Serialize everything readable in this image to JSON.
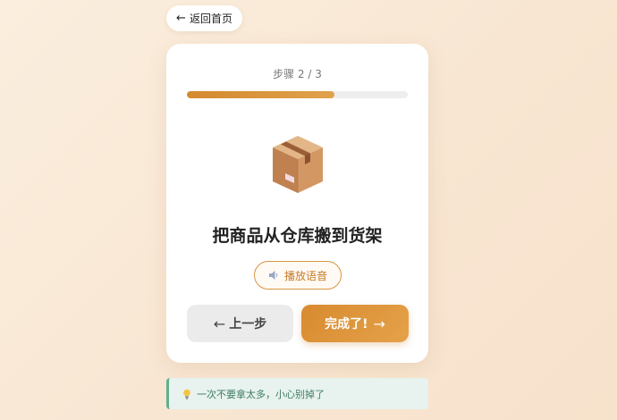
{
  "nav": {
    "back_arrow": "←",
    "back_label": "返回首页"
  },
  "progress": {
    "label": "步骤 2 / 3",
    "current": 2,
    "total": 3,
    "fraction": 0.667
  },
  "task": {
    "icon": "package-box-icon",
    "title": "把商品从仓库搬到货架"
  },
  "audio": {
    "icon": "speaker-icon",
    "label": "播放语音"
  },
  "buttons": {
    "prev_arrow": "←",
    "prev_label": "上一步",
    "next_label": "完成了!",
    "next_arrow": "→"
  },
  "tip": {
    "icon": "lightbulb-icon",
    "text": "一次不要拿太多，小心别掉了"
  },
  "colors": {
    "accent": "#dc8f35",
    "tip_border": "#5fb08d",
    "tip_background": "#e8f2ee"
  }
}
